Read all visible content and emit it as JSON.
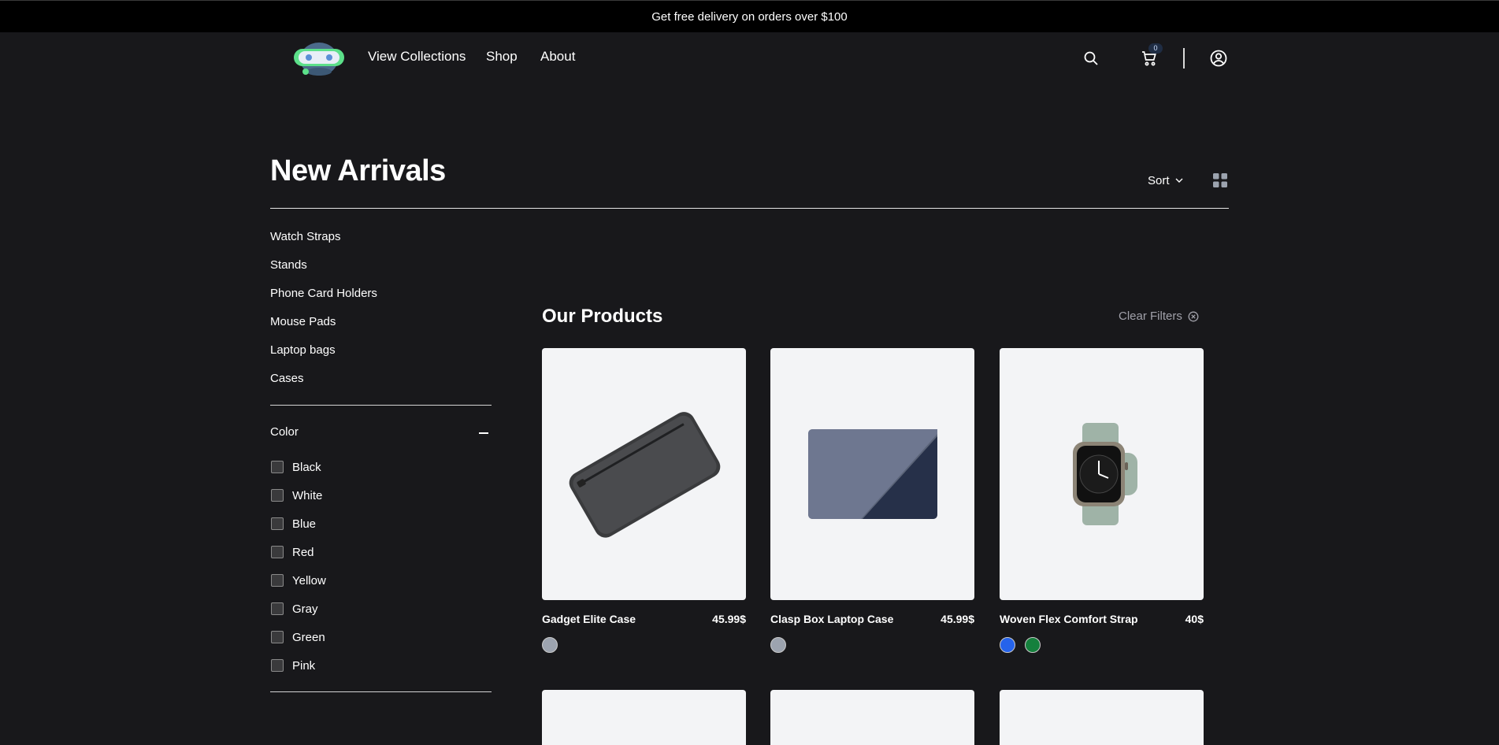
{
  "banner": {
    "text": "Get free delivery on orders over $100"
  },
  "nav": {
    "logo_icon": "robot-mascot-logo",
    "links": [
      "View Collections",
      "Shop",
      "About"
    ],
    "cart_count": "0"
  },
  "page": {
    "title": "New Arrivals",
    "sort_label": "Sort"
  },
  "sidebar": {
    "categories": [
      "Watch Straps",
      "Stands",
      "Phone Card Holders",
      "Mouse Pads",
      "Laptop bags",
      "Cases"
    ],
    "color_filter_label": "Color",
    "colors": [
      "Black",
      "White",
      "Blue",
      "Red",
      "Yellow",
      "Gray",
      "Green",
      "Pink"
    ]
  },
  "products_section": {
    "title": "Our Products",
    "clear_filters": "Clear Filters",
    "products": [
      {
        "name": "Gadget Elite Case",
        "price": "45.99$",
        "swatches": [
          "#9ca3af"
        ]
      },
      {
        "name": "Clasp Box Laptop Case",
        "price": "45.99$",
        "swatches": [
          "#9ca3af"
        ]
      },
      {
        "name": "Woven Flex Comfort Strap",
        "price": "40$",
        "swatches": [
          "#2563eb",
          "#15803d"
        ]
      }
    ]
  },
  "colors": {
    "background": "#18181b",
    "banner_bg": "#000000",
    "card_bg": "#f3f4f6",
    "muted_text": "#a1a1aa"
  }
}
